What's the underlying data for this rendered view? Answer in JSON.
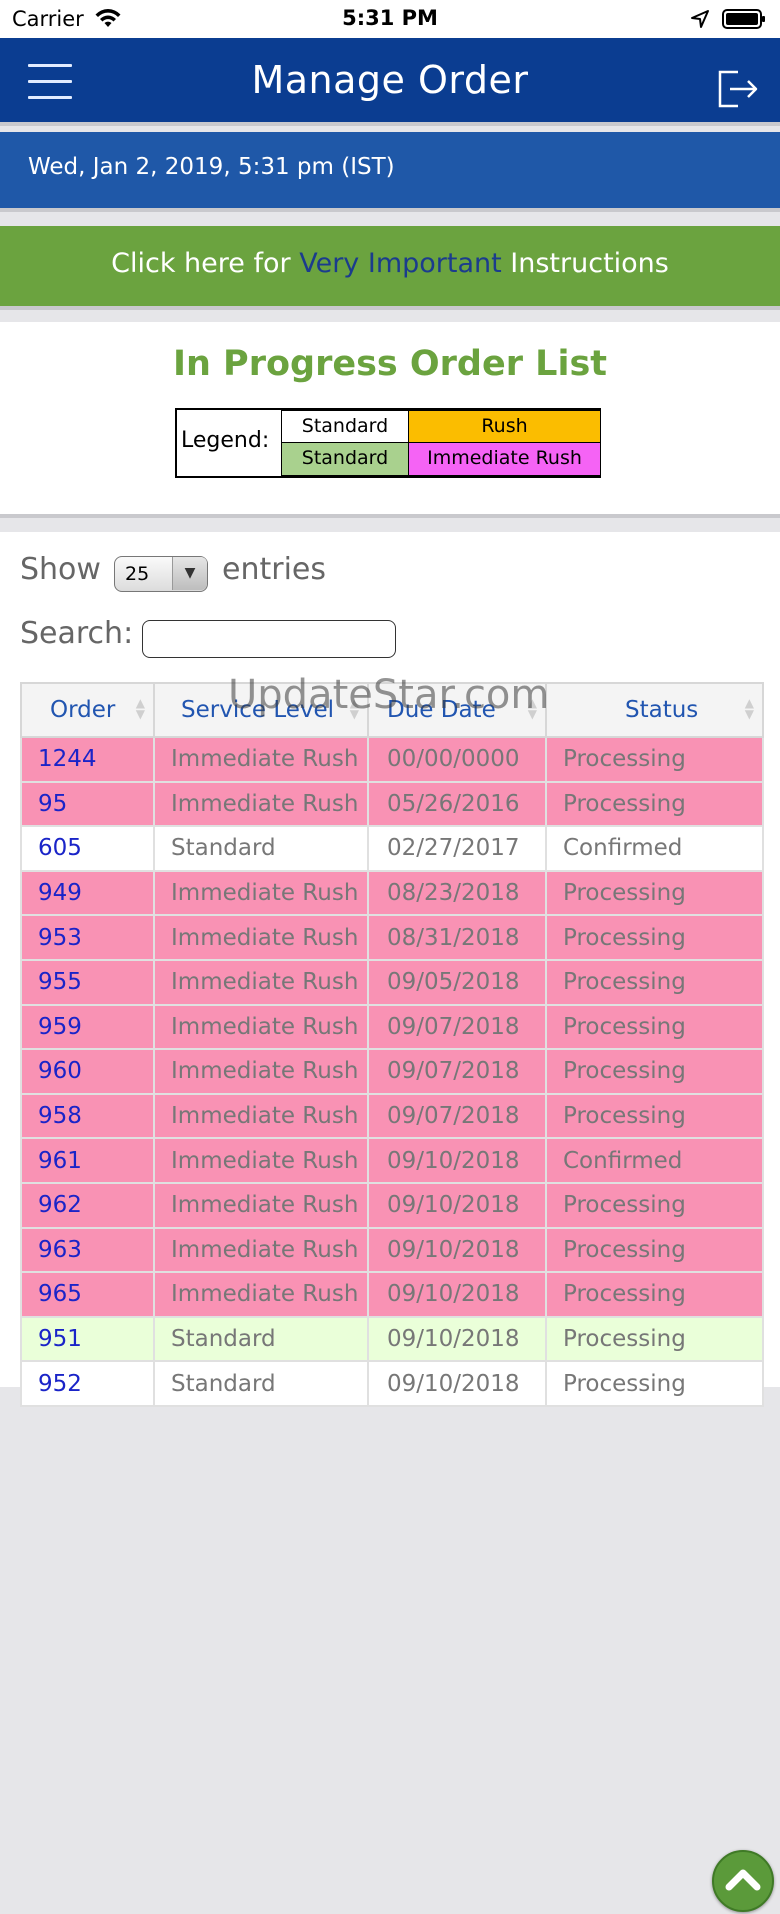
{
  "status_bar": {
    "carrier": "Carrier",
    "time": "5:31 PM"
  },
  "header": {
    "title": "Manage Order",
    "menu_icon": "hamburger-menu-icon",
    "logout_icon": "logout-icon",
    "color": "#0b3d91"
  },
  "date_bar": {
    "text": "Wed, Jan 2, 2019, 5:31 pm (IST)"
  },
  "instructions": {
    "prefix": "Click here for ",
    "link": "Very Important",
    "suffix": " Instructions",
    "color": "#6ba33f"
  },
  "order_list": {
    "title": "In Progress Order List",
    "legend": {
      "label": "Legend:",
      "items": [
        {
          "label": "Standard",
          "color": "#ffffff"
        },
        {
          "label": "Rush",
          "color": "#fbbd00"
        },
        {
          "label": "Standard",
          "color": "#a9d18e"
        },
        {
          "label": "Immediate Rush",
          "color": "#f563f5"
        }
      ]
    }
  },
  "table_controls": {
    "show_label": "Show",
    "entries_value": "25",
    "entries_label": "entries",
    "search_label": "Search:",
    "search_value": ""
  },
  "table": {
    "columns": [
      "Order",
      "Service Level",
      "Due Date",
      "Status"
    ],
    "rows": [
      {
        "order": "1244",
        "service": "Immediate Rush",
        "due": "00/00/0000",
        "status": "Processing",
        "style": "pink"
      },
      {
        "order": "95",
        "service": "Immediate Rush",
        "due": "05/26/2016",
        "status": "Processing",
        "style": "pink"
      },
      {
        "order": "605",
        "service": "Standard",
        "due": "02/27/2017",
        "status": "Confirmed",
        "style": "white"
      },
      {
        "order": "949",
        "service": "Immediate Rush",
        "due": "08/23/2018",
        "status": "Processing",
        "style": "pink"
      },
      {
        "order": "953",
        "service": "Immediate Rush",
        "due": "08/31/2018",
        "status": "Processing",
        "style": "pink"
      },
      {
        "order": "955",
        "service": "Immediate Rush",
        "due": "09/05/2018",
        "status": "Processing",
        "style": "pink"
      },
      {
        "order": "959",
        "service": "Immediate Rush",
        "due": "09/07/2018",
        "status": "Processing",
        "style": "pink"
      },
      {
        "order": "960",
        "service": "Immediate Rush",
        "due": "09/07/2018",
        "status": "Processing",
        "style": "pink"
      },
      {
        "order": "958",
        "service": "Immediate Rush",
        "due": "09/07/2018",
        "status": "Processing",
        "style": "pink"
      },
      {
        "order": "961",
        "service": "Immediate Rush",
        "due": "09/10/2018",
        "status": "Confirmed",
        "style": "pink"
      },
      {
        "order": "962",
        "service": "Immediate Rush",
        "due": "09/10/2018",
        "status": "Processing",
        "style": "pink"
      },
      {
        "order": "963",
        "service": "Immediate Rush",
        "due": "09/10/2018",
        "status": "Processing",
        "style": "pink"
      },
      {
        "order": "965",
        "service": "Immediate Rush",
        "due": "09/10/2018",
        "status": "Processing",
        "style": "pink"
      },
      {
        "order": "951",
        "service": "Standard",
        "due": "09/10/2018",
        "status": "Processing",
        "style": "green"
      },
      {
        "order": "952",
        "service": "Standard",
        "due": "09/10/2018",
        "status": "Processing",
        "style": "white"
      }
    ]
  },
  "watermark": "UpdateStar.com",
  "scroll_top_icon": "chevron-up-icon"
}
